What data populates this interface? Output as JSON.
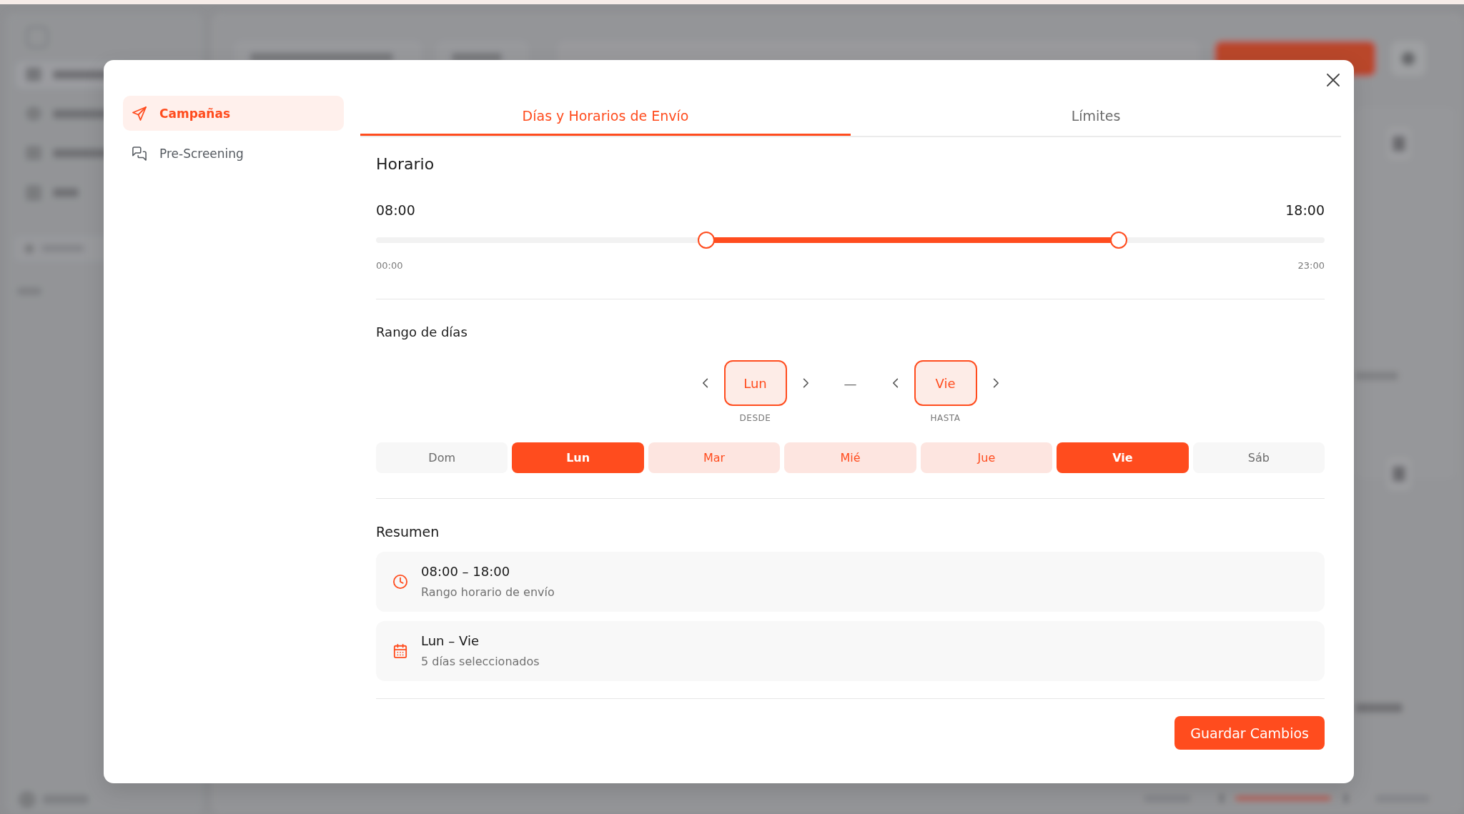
{
  "sidebar": {
    "items": [
      {
        "label": "Campañas",
        "selected": true
      },
      {
        "label": "Pre-Screening",
        "selected": false
      }
    ]
  },
  "tabs": [
    {
      "label": "Días y Horarios de Envío",
      "selected": true
    },
    {
      "label": "Límites",
      "selected": false
    }
  ],
  "schedule": {
    "title": "Horario",
    "start_time": "08:00",
    "end_time": "18:00",
    "thumbs": [
      {
        "level": 0.348
      },
      {
        "level": 0.783
      }
    ],
    "min_label": "00:00",
    "max_label": "23:00"
  },
  "day_range": {
    "title": "Rango de días",
    "from": {
      "value": "Lun",
      "caption": "DESDE"
    },
    "separator": "—",
    "to": {
      "value": "Vie",
      "caption": "HASTA"
    },
    "days": [
      {
        "label": "Dom",
        "selected": false,
        "endpoint": false
      },
      {
        "label": "Lun",
        "selected": true,
        "endpoint": true
      },
      {
        "label": "Mar",
        "selected": true,
        "endpoint": false
      },
      {
        "label": "Mié",
        "selected": true,
        "endpoint": false
      },
      {
        "label": "Jue",
        "selected": true,
        "endpoint": false
      },
      {
        "label": "Vie",
        "selected": true,
        "endpoint": true
      },
      {
        "label": "Sáb",
        "selected": false,
        "endpoint": false
      }
    ]
  },
  "summary": {
    "title": "Resumen",
    "items": [
      {
        "title": "08:00 – 18:00",
        "subtitle": "Rango horario de envío"
      },
      {
        "title": "Lun – Vie",
        "subtitle": "5 días seleccionados"
      }
    ]
  },
  "save_button": "Guardar Cambios"
}
